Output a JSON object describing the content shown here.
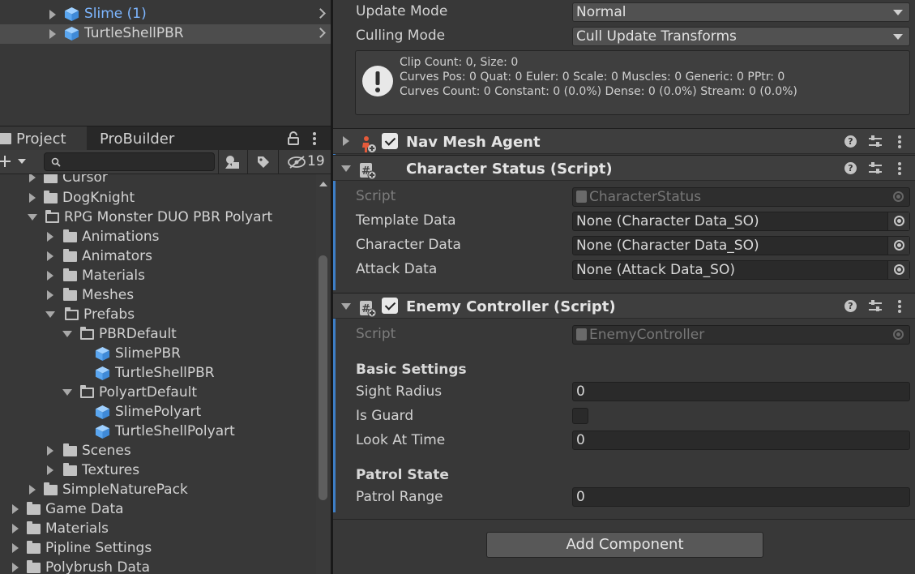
{
  "hierarchy": {
    "items": [
      {
        "label": "Slime (1)",
        "color": "#7db6ff"
      },
      {
        "label": "TurtleShellPBR",
        "color": "#d2d2d2"
      }
    ]
  },
  "project": {
    "tabs": [
      "Project",
      "ProBuilder"
    ],
    "hidden_count": "19",
    "tree": [
      "Cursor",
      "DogKnight",
      "RPG Monster DUO PBR Polyart",
      "Animations",
      "Animators",
      "Materials",
      "Meshes",
      "Prefabs",
      "PBRDefault",
      "SlimePBR",
      "TurtleShellPBR",
      "PolyartDefault",
      "SlimePolyart",
      "TurtleShellPolyart",
      "Scenes",
      "Textures",
      "SimpleNaturePack",
      "Game Data",
      "Materials",
      "Pipline Settings",
      "Polybrush Data"
    ]
  },
  "inspector": {
    "animator": {
      "update_mode_label": "Update Mode",
      "update_mode_value": "Normal",
      "culling_mode_label": "Culling Mode",
      "culling_mode_value": "Cull Update Transforms",
      "info_line1": "Clip Count: 0, Size: 0",
      "info_line2": "Curves Pos: 0 Quat: 0 Euler: 0 Scale: 0 Muscles: 0 Generic: 0 PPtr: 0",
      "info_line3": "Curves Count: 0 Constant: 0 (0.0%) Dense: 0 (0.0%) Stream: 0 (0.0%)"
    },
    "nav_mesh_agent": {
      "title": "Nav Mesh Agent"
    },
    "character_status": {
      "title": "Character Status (Script)",
      "script_label": "Script",
      "script_value": "CharacterStatus",
      "template_label": "Template Data",
      "template_value": "None (Character Data_SO)",
      "character_label": "Character Data",
      "character_value": "None (Character Data_SO)",
      "attack_label": "Attack Data",
      "attack_value": "None (Attack Data_SO)"
    },
    "enemy_controller": {
      "title": "Enemy Controller (Script)",
      "script_label": "Script",
      "script_value": "EnemyController",
      "basic_settings": "Basic Settings",
      "sight_radius_label": "Sight Radius",
      "sight_radius_value": "0",
      "is_guard_label": "Is Guard",
      "look_at_time_label": "Look At Time",
      "look_at_time_value": "0",
      "patrol_state": "Patrol State",
      "patrol_range_label": "Patrol Range",
      "patrol_range_value": "0"
    },
    "add_component": "Add Component"
  },
  "colors": {
    "accent": "#3d7ec6",
    "prefab_blue": "#7db6ff"
  }
}
